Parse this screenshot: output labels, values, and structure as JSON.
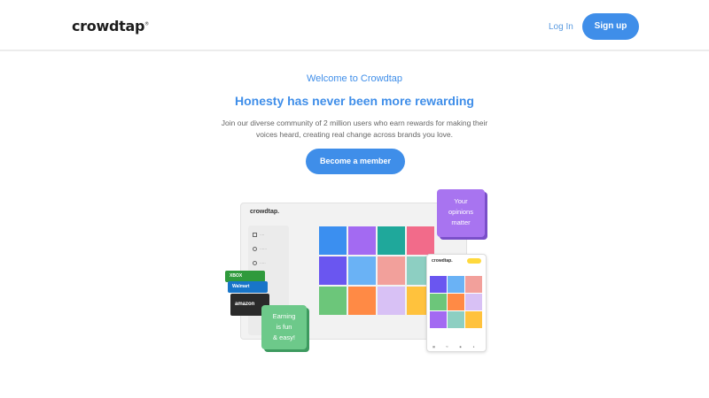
{
  "header": {
    "logo_text": "crowdtap",
    "login_label": "Log In",
    "signup_label": "Sign up"
  },
  "hero": {
    "welcome": "Welcome to Crowdtap",
    "headline": "Honesty has never been more rewarding",
    "description_line1": "Join our diverse community of 2 million users who earn rewards for making their",
    "description_line2": "voices heard, creating real change across brands you love.",
    "cta_label": "Become a member"
  },
  "illustration": {
    "desktop_logo": "crowdtap.",
    "phone_logo": "crowdtap.",
    "bubble_purple": [
      "Your",
      "opinions",
      "matter"
    ],
    "bubble_green": [
      "Earning",
      "is fun",
      "& easy!"
    ],
    "cards": {
      "xbox": "XBOX",
      "walmart": "Walmart",
      "amazon": "amazon"
    }
  },
  "colors": {
    "brand": "#3f8ee9",
    "tile_colors": [
      "#3b8ff0",
      "#a36af2",
      "#1fa89b",
      "#f26b8a",
      "#6a56f0",
      "#6ab2f5",
      "#f2a09b",
      "#8dcfc2",
      "#6cc67a",
      "#ff8a45",
      "#d8c1f5",
      "#ffc23d"
    ]
  }
}
